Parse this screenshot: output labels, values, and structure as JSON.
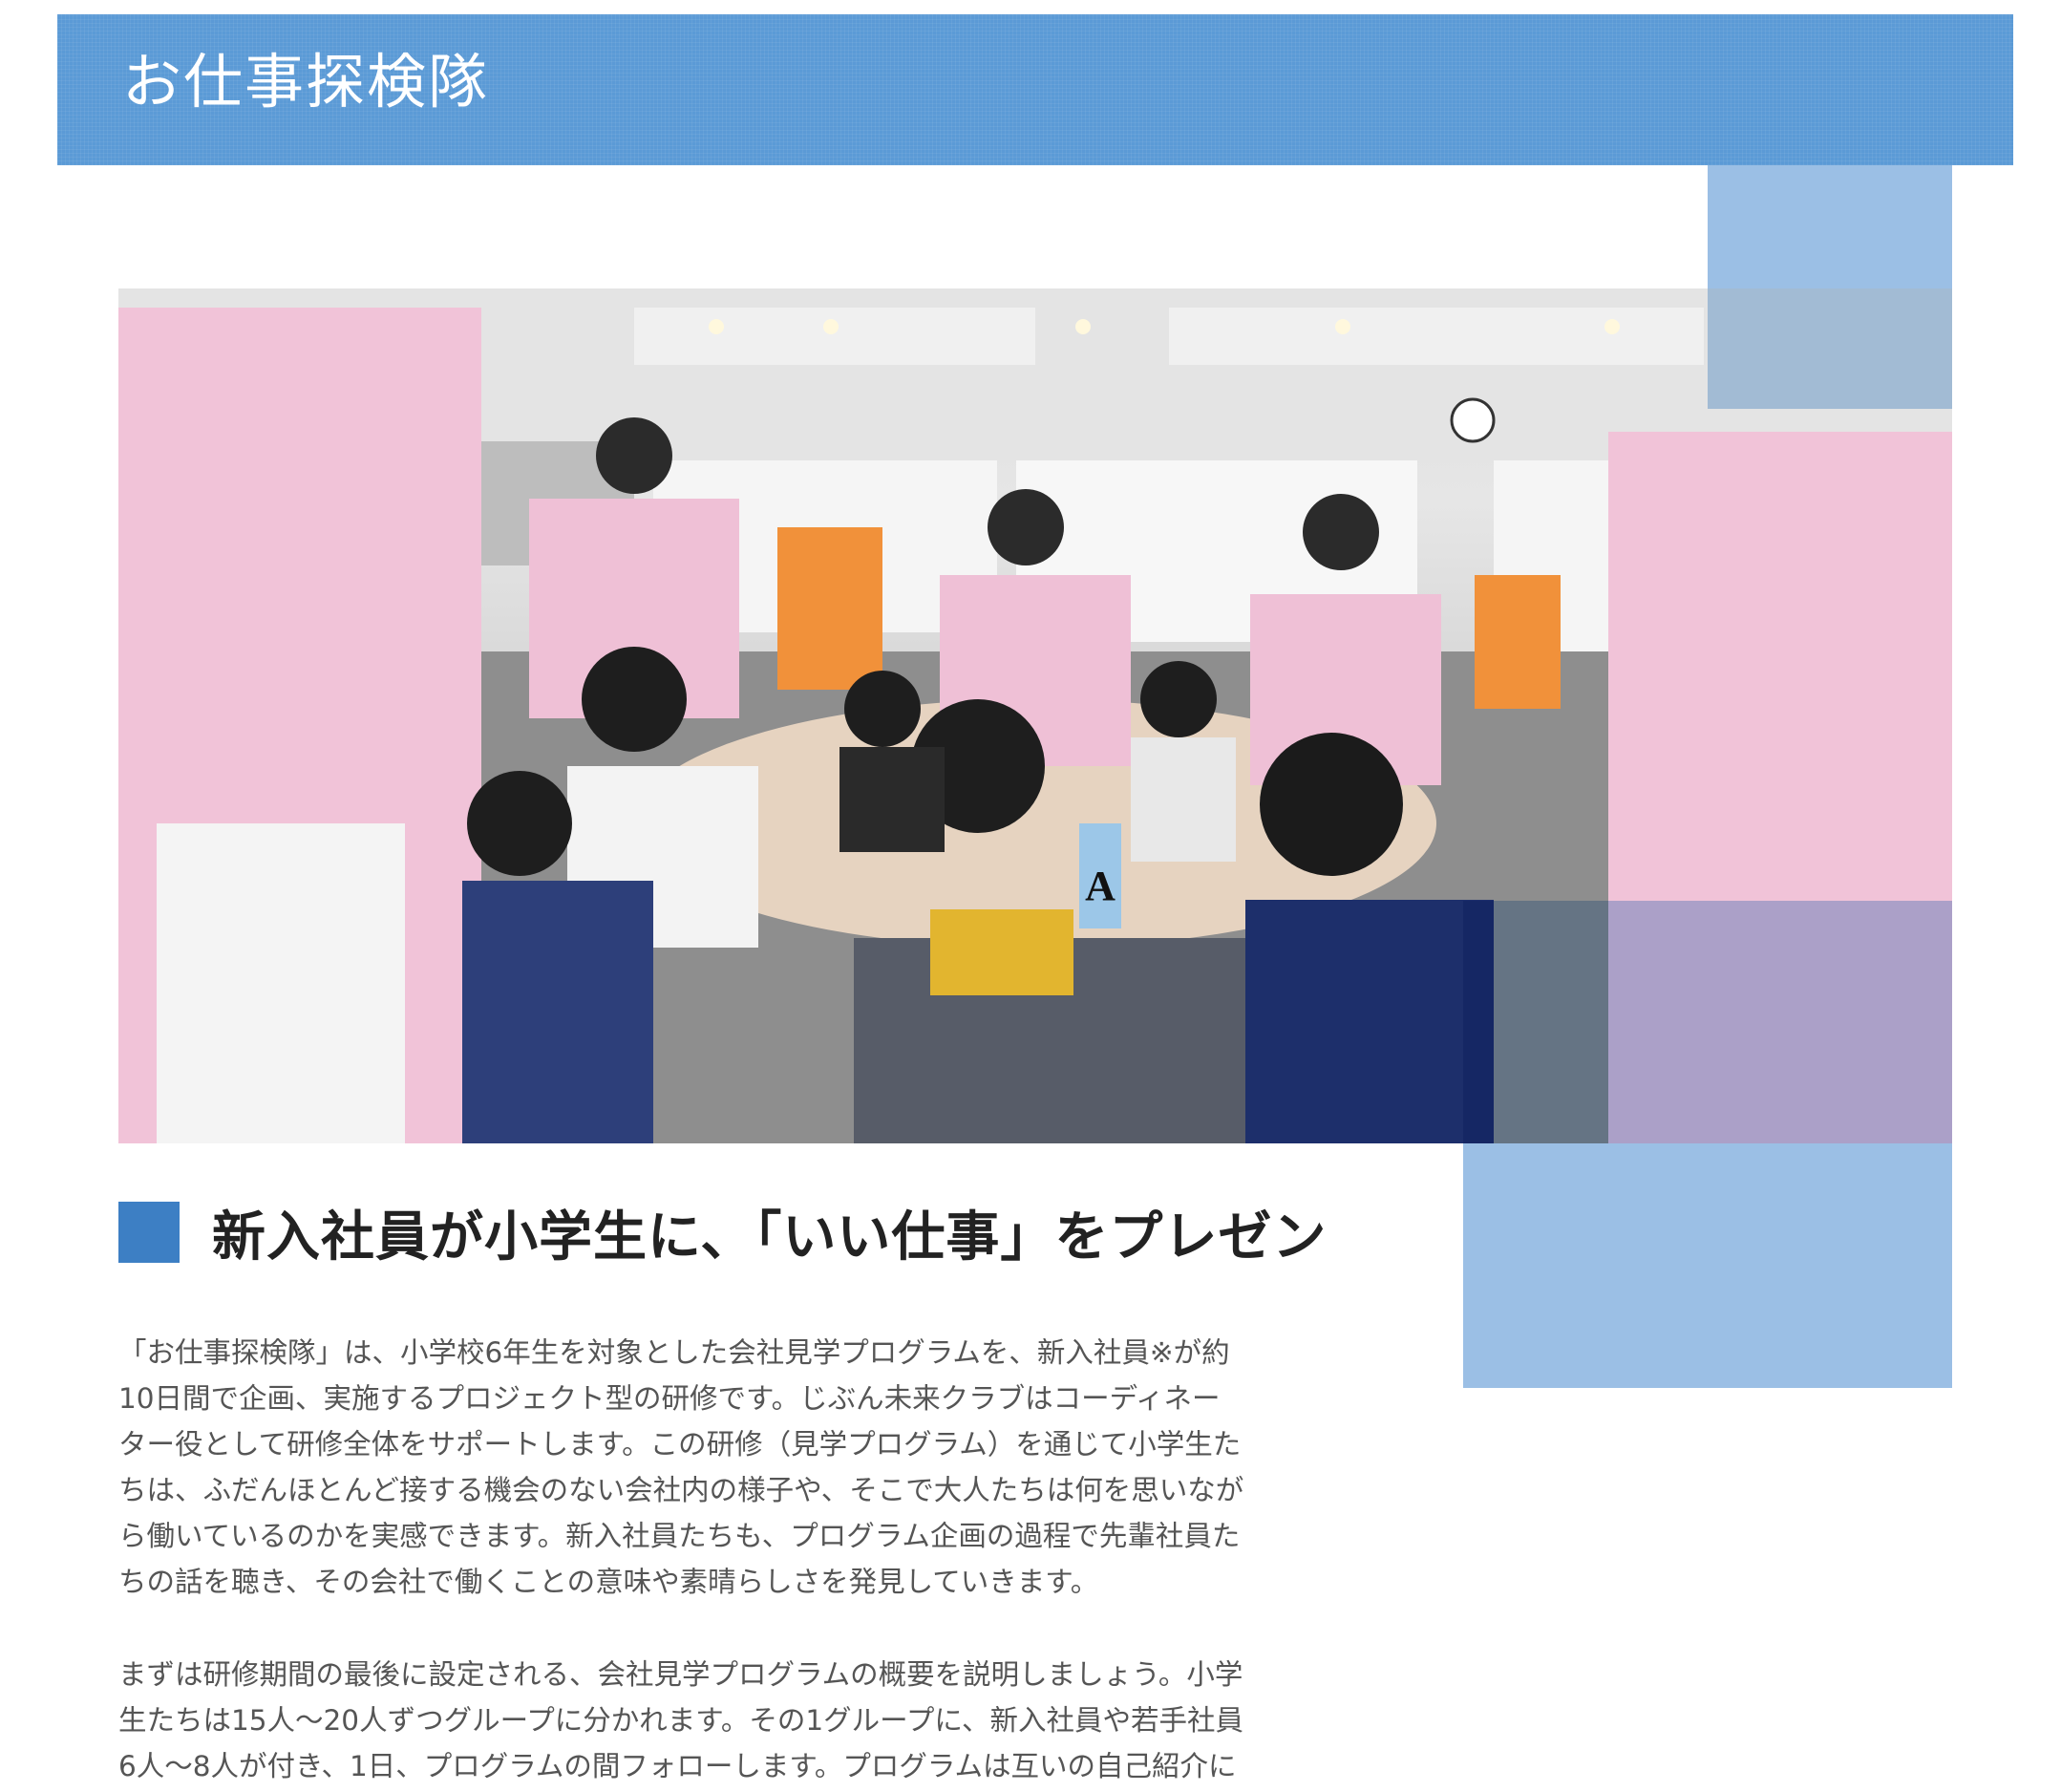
{
  "header": {
    "title": "お仕事探検隊"
  },
  "hero_image": {
    "description_icon": "photo-image",
    "sign_letter": "A"
  },
  "section": {
    "heading": "新入社員が小学生に、「いい仕事」をプレゼン"
  },
  "body": {
    "paragraph1_lines": [
      "「お仕事探検隊」は、小学校6年生を対象とした会社見学プログラムを、新入社員※が約",
      "10日間で企画、実施するプロジェクト型の研修です。じぶん未来クラブはコーディネー",
      "ター役として研修全体をサポートします。この研修（見学プログラム）を通じて小学生た",
      "ちは、ふだんほとんど接する機会のない会社内の様子や、そこで大人たちは何を思いなが",
      "ら働いているのかを実感できます。新入社員たちも、プログラム企画の過程で先輩社員た",
      "ちの話を聴き、その会社で働くことの意味や素晴らしさを発見していきます。"
    ],
    "paragraph2_lines": [
      "まずは研修期間の最後に設定される、会社見学プログラムの概要を説明しましょう。小学",
      "生たちは15人〜20人ずつグループに分かれます。その1グループに、新入社員や若手社員",
      "6人〜8人が付き、1日、プログラムの間フォローします。プログラムは互いの自己紹介に"
    ]
  },
  "colors": {
    "header_bg": "#5b9ad6",
    "accent_square": "#3d7fc4",
    "deco_block": "#9bbfe5",
    "body_text": "#555555",
    "heading_text": "#222222"
  }
}
